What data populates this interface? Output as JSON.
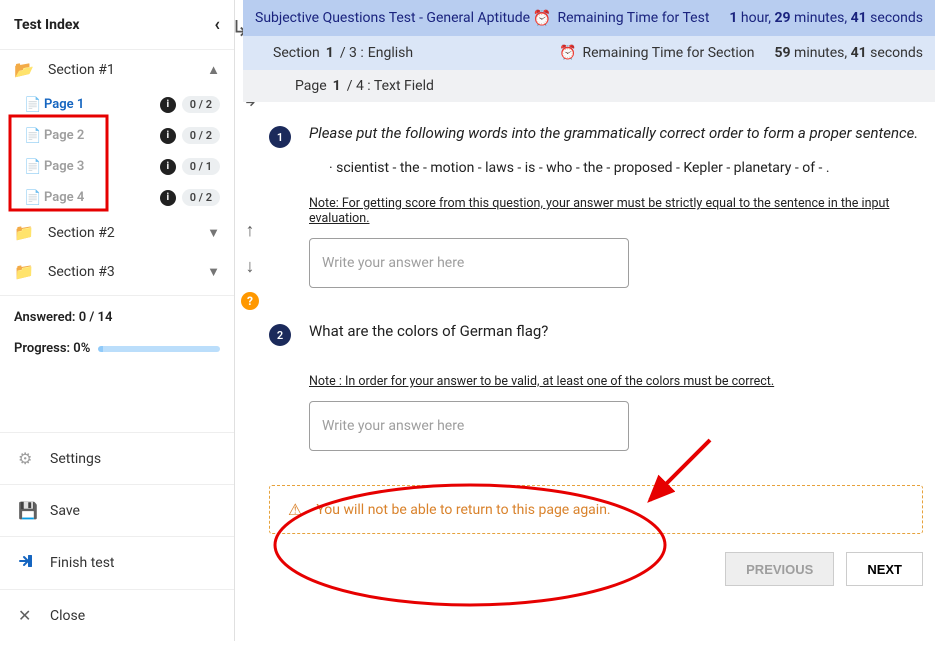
{
  "testIndexTitle": "Test Index",
  "sections": [
    {
      "label": "Section #1",
      "open": true
    },
    {
      "label": "Section #2",
      "open": false
    },
    {
      "label": "Section #3",
      "open": false
    }
  ],
  "pages": [
    {
      "label": "Page 1",
      "score": "0 / 2",
      "active": true
    },
    {
      "label": "Page 2",
      "score": "0 / 2",
      "active": false
    },
    {
      "label": "Page 3",
      "score": "0 / 1",
      "active": false
    },
    {
      "label": "Page 4",
      "score": "0 / 2",
      "active": false
    }
  ],
  "answered": "Answered: 0 / 14",
  "progress": "Progress: 0%",
  "menu": {
    "settings": "Settings",
    "save": "Save",
    "finish": "Finish test",
    "close": "Close"
  },
  "topbar": {
    "title": "Subjective Questions Test - General Aptitude",
    "remainTestLabel": "Remaining Time for Test",
    "remainTestValue": "1 hour, 29 minutes, 41 seconds"
  },
  "secbar": {
    "sectionLabel": "Section",
    "sectionPos": "1",
    "sectionTotal": "/ 3 :",
    "sectionName": "English",
    "remainSecLabel": "Remaining Time for Section",
    "remainSecValue": "59 minutes, 41 seconds"
  },
  "pagebar": {
    "pageLabel": "Page",
    "pagePos": "1",
    "pageRest": "/ 4 : Text Field"
  },
  "q1": {
    "text": "Please put the following words into the grammatically correct order to form a proper sentence.",
    "words": "· scientist - the - motion - laws - is - who - the - proposed - Kepler - planetary - of - .",
    "note": "Note: For getting score from this question, your answer must be strictly equal to the sentence in the input evaluation.",
    "placeholder": "Write your answer here"
  },
  "q2": {
    "text": "What are the colors of German flag?",
    "note": "Note : In order for your answer to be valid, at least one of the colors must be correct.",
    "placeholder": "Write your answer here"
  },
  "warning": "You will not be able to return to this page again.",
  "buttons": {
    "prev": "PREVIOUS",
    "next": "NEXT"
  }
}
